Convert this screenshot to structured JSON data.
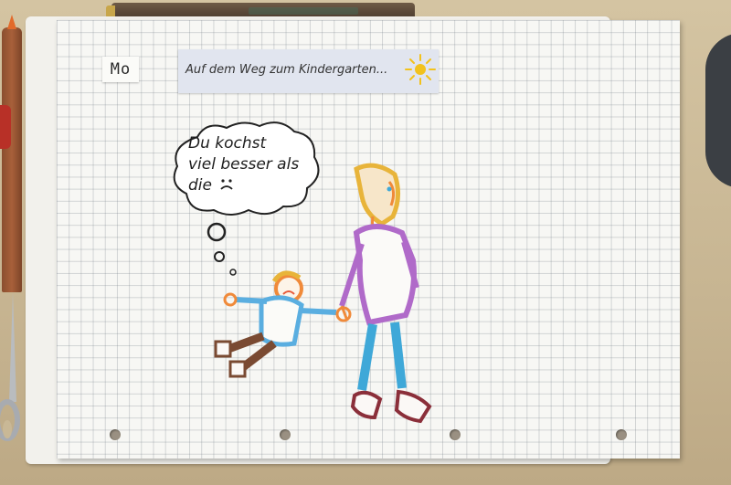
{
  "page_label": "Mo",
  "title": "Auf dem Weg zum Kindergarten...",
  "speech": {
    "lines": [
      "Du kochst",
      "viel besser als",
      "die"
    ]
  },
  "colors": {
    "paper": "#f7f7f4",
    "title_strip": "#e1e5ef",
    "mother_top": "#b06ac9",
    "pants": "#3fa8d8",
    "hair": "#e8b43a",
    "skin": "#f08a3a",
    "child_shirt": "#5aaee0",
    "child_pants": "#7a4a32",
    "shoes": "#8b2f3a"
  },
  "icons": [
    "sun-icon",
    "sad-face-icon",
    "thought-bubble-icon"
  ]
}
